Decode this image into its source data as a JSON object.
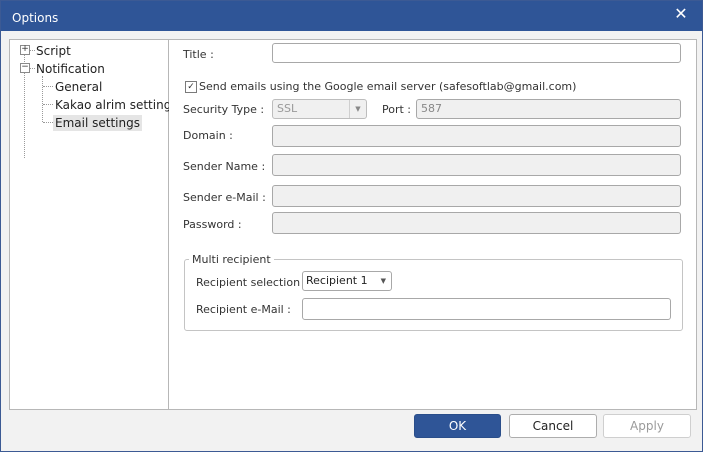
{
  "window": {
    "title": "Options",
    "close_symbol": "✕"
  },
  "tree": {
    "nodes": [
      {
        "label": "Script",
        "expander": "+"
      },
      {
        "label": "Notification",
        "expander": "−"
      },
      {
        "label": "General"
      },
      {
        "label": "Kakao alrim settings"
      },
      {
        "label": "Email settings",
        "selected": true
      }
    ]
  },
  "form": {
    "title_label": "Title :",
    "title_value": "",
    "google_checkbox_checked": true,
    "google_checkbox_label": "Send emails using the Google email server (safesoftlab@gmail.com)",
    "security_type_label": "Security Type :",
    "security_type_value": "SSL",
    "port_label": "Port :",
    "port_value": "587",
    "domain_label": "Domain :",
    "domain_value": "",
    "sender_name_label": "Sender Name :",
    "sender_name_value": "",
    "sender_email_label": "Sender e-Mail :",
    "sender_email_value": "",
    "password_label": "Password :",
    "password_value": "",
    "multi_recipient": {
      "legend": "Multi recipient",
      "selection_label": "Recipient selection :",
      "selection_value": "Recipient 1",
      "email_label": "Recipient e-Mail :",
      "email_value": ""
    }
  },
  "buttons": {
    "ok": "OK",
    "cancel": "Cancel",
    "apply": "Apply"
  },
  "colors": {
    "title_bar": "#2f5597",
    "primary_button": "#2f5597"
  }
}
